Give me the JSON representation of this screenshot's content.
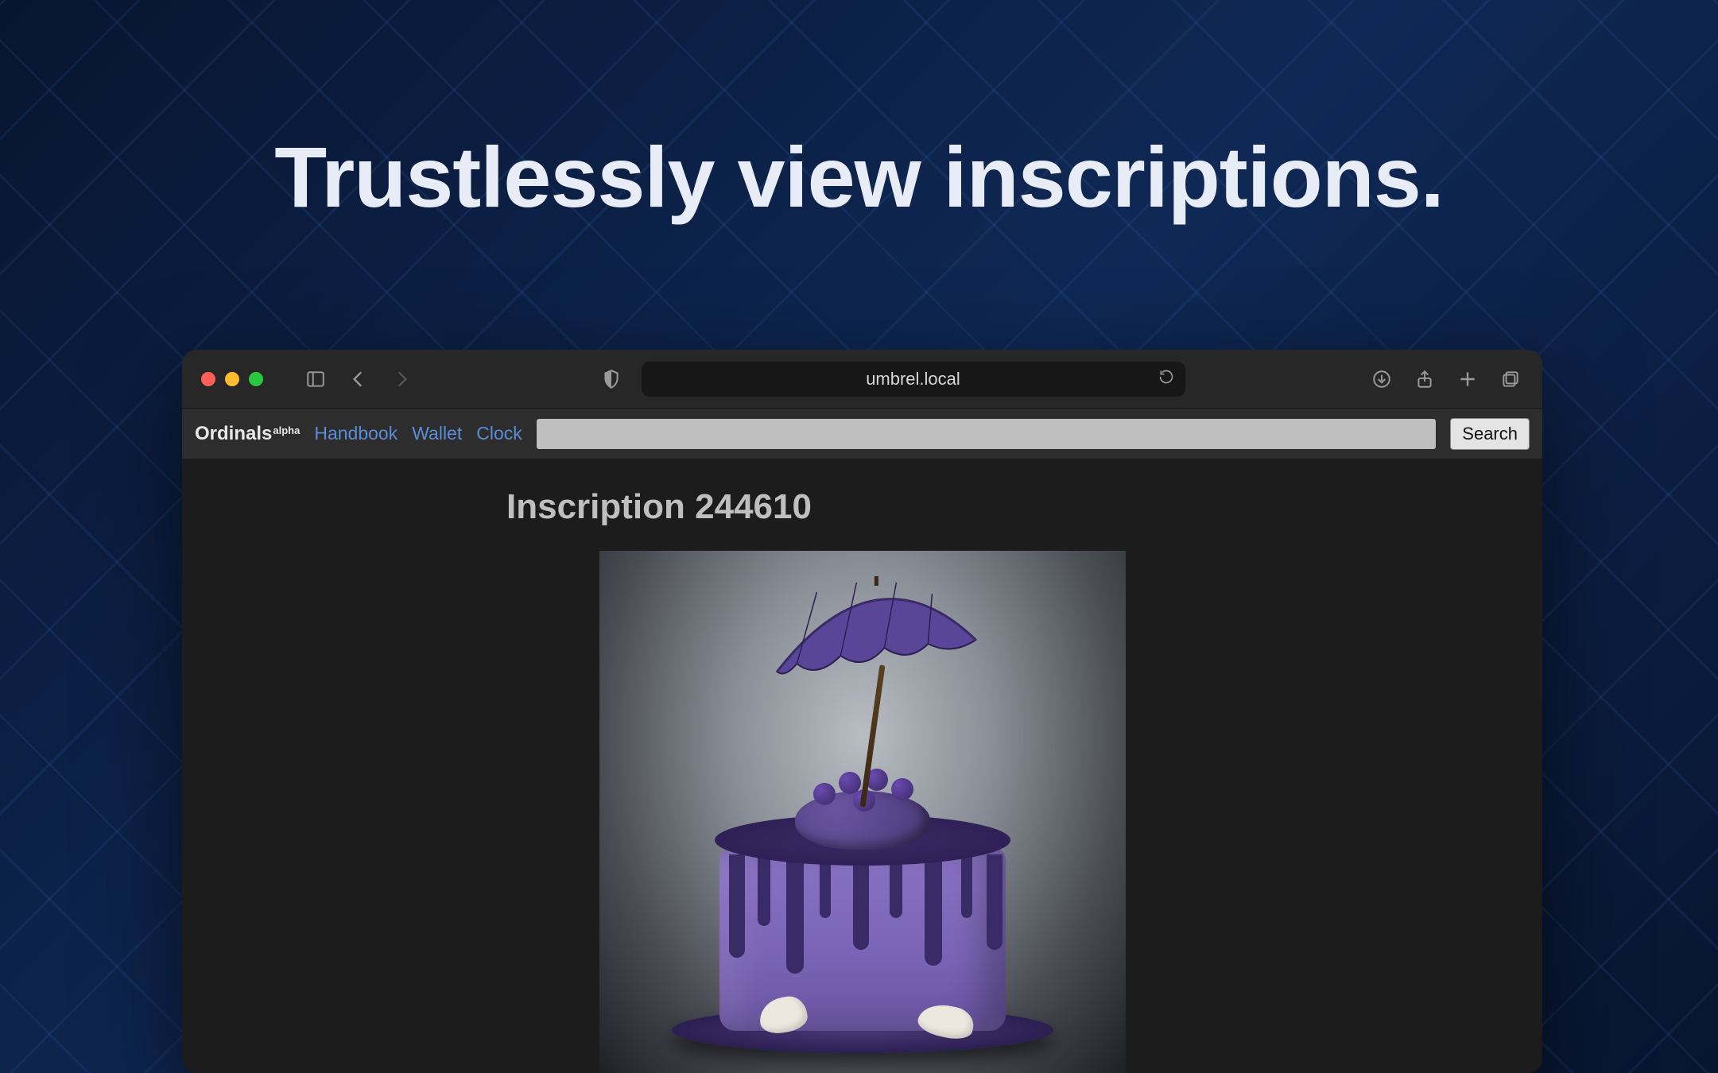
{
  "hero": {
    "title": "Trustlessly view inscriptions."
  },
  "browser": {
    "url": "umbrel.local"
  },
  "app": {
    "brand_name": "Ordinals",
    "brand_sup": "alpha",
    "nav": {
      "handbook": "Handbook",
      "wallet": "Wallet",
      "clock": "Clock"
    },
    "search_button": "Search"
  },
  "page": {
    "heading": "Inscription 244610"
  }
}
